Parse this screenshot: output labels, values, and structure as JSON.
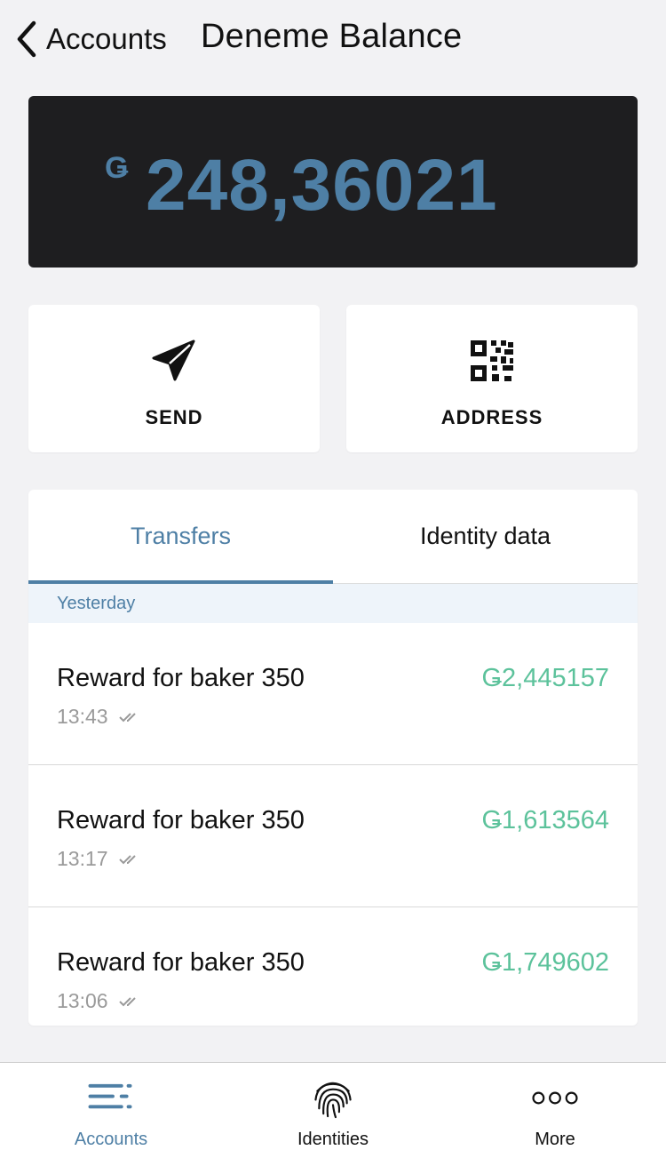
{
  "header": {
    "back_label": "Accounts",
    "title": "Deneme Balance"
  },
  "balance": {
    "symbol": "Ǥ",
    "value": "248,36021"
  },
  "actions": [
    {
      "label": "SEND",
      "icon": "send-icon"
    },
    {
      "label": "ADDRESS",
      "icon": "qr-code-icon"
    }
  ],
  "tabs": [
    {
      "label": "Transfers",
      "active": true
    },
    {
      "label": "Identity data",
      "active": false
    }
  ],
  "transfers": {
    "group_label": "Yesterday",
    "items": [
      {
        "title": "Reward for baker 350",
        "time": "13:43",
        "amount": "Ǥ2,445157"
      },
      {
        "title": "Reward for baker 350",
        "time": "13:17",
        "amount": "Ǥ1,613564"
      },
      {
        "title": "Reward for baker 350",
        "time": "13:06",
        "amount": "Ǥ1,749602"
      }
    ]
  },
  "bottom_nav": [
    {
      "label": "Accounts",
      "icon": "accounts-list-icon",
      "active": true
    },
    {
      "label": "Identities",
      "icon": "fingerprint-icon",
      "active": false
    },
    {
      "label": "More",
      "icon": "more-dots-icon",
      "active": false
    }
  ],
  "colors": {
    "accent": "#4e7fa5",
    "positive_amount": "#5cc29b",
    "balance_card": "#1e1e20",
    "group_header_bg": "#eef4fa"
  }
}
